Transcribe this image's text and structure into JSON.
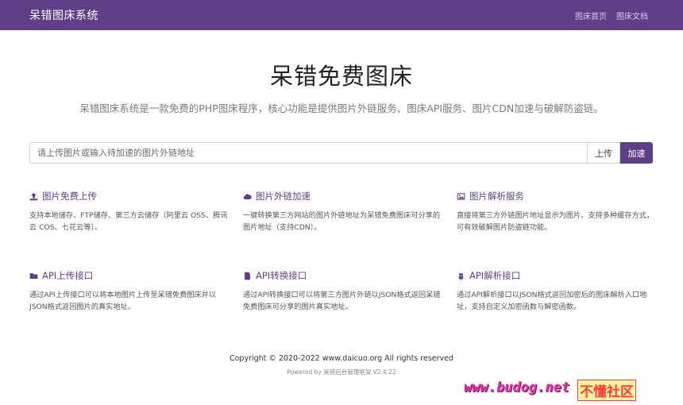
{
  "navbar": {
    "brand": "呆错图床系统",
    "links": [
      "图床首页",
      "图床文档"
    ]
  },
  "hero": {
    "title": "呆错免费图床",
    "subtitle": "呆错图床系统是一款免费的PHP图床程序，核心功能是提供图片外链服务、图床API服务、图片CDN加速与破解防盗链。"
  },
  "search": {
    "placeholder": "请上传图片或输入待加速的图片外链地址",
    "value": "",
    "upload_label": "上传",
    "speed_label": "加速"
  },
  "features": [
    {
      "icon": "upload-icon",
      "title": "图片免费上传",
      "desc": "支持本地储存、FTP储存、第三方云储存（阿里云 OSS、腾讯云 COS、七花云等）。"
    },
    {
      "icon": "cloud-icon",
      "title": "图片外链加速",
      "desc": "一键转换第三方网站的图片外链地址为呆错免费图床可分享的图片地址（支持CDN）。"
    },
    {
      "icon": "image-icon",
      "title": "图片解析服务",
      "desc": "直接将第三方外链图片地址显示为图片、支持多种缓存方式，可有效破解图片防盗链功能。"
    },
    {
      "icon": "folder-icon",
      "title": "API上传接口",
      "desc": "通过API上传接口可以将本地图片上传至呆错免费图床并以JSON格式返回图片的真实地址。"
    },
    {
      "icon": "file-icon",
      "title": "API转换接口",
      "desc": "通过API转换接口可以将第三方图片外链以JSON格式返回呆错免费图床可分享的图片真实地址。"
    },
    {
      "icon": "android-icon",
      "title": "API解析接口",
      "desc": "通过API解析接口以JSON格式返回加密后的图床解析入口地址，支持自定义加密函数与解密函数。"
    }
  ],
  "footer": {
    "copyright": "Copyright © 2020-2022 www.daicuo.org All rights reserved",
    "powered": "Powered by 呆错后台管理框架 V2.4.22"
  },
  "watermark": {
    "url": "www.budog.net",
    "text": "不懂社区"
  },
  "colors": {
    "brand": "#5f3f88",
    "watermark": "#e23aa8"
  }
}
